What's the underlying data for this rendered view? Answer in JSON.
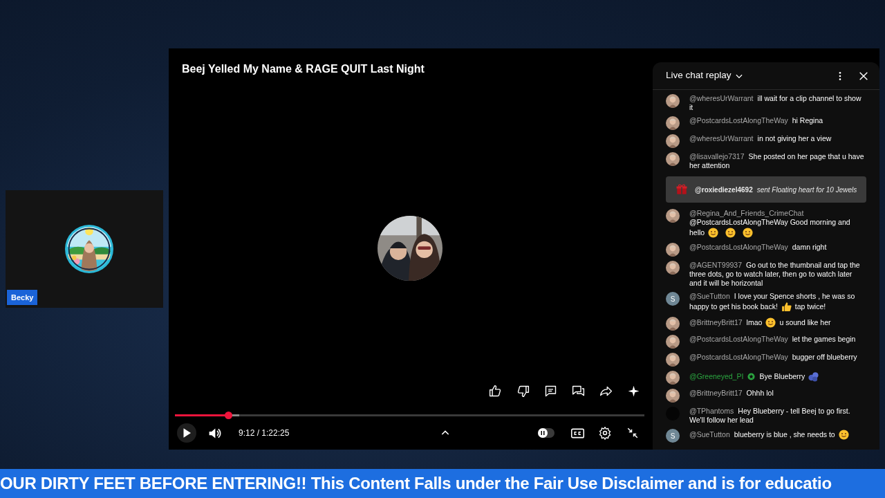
{
  "camera_tile": {
    "name_tag": "Becky"
  },
  "player": {
    "title": "Beej Yelled My Name & RAGE QUIT Last Night",
    "progress": {
      "level": 0.113
    },
    "buffer": {
      "level": 0.137
    },
    "playing": false,
    "time": "9:12 / 1:22:25",
    "autoplay": {
      "on": false
    }
  },
  "chat": {
    "title": "Live chat replay",
    "messages": [
      {
        "kind": "message",
        "badge": false,
        "avatar": {
          "kind": "picture"
        },
        "lines": [
          [
            {
              "kind": "author",
              "text": "@wheresUrWarrant",
              "color": "#aaaaaa"
            },
            {
              "kind": "text",
              "text": "ill wait for a clip channel to show"
            }
          ],
          [
            {
              "kind": "text",
              "text": "it"
            }
          ]
        ]
      },
      {
        "kind": "message",
        "badge": false,
        "avatar": {
          "kind": "picture"
        },
        "lines": [
          [
            {
              "kind": "author",
              "text": "@PostcardsLostAlongTheWay",
              "color": "#aaaaaa"
            },
            {
              "kind": "text",
              "text": "hi Regina"
            }
          ]
        ]
      },
      {
        "kind": "message",
        "badge": false,
        "avatar": {
          "kind": "picture"
        },
        "lines": [
          [
            {
              "kind": "author",
              "text": "@wheresUrWarrant",
              "color": "#aaaaaa"
            },
            {
              "kind": "text",
              "text": "in not giving her a view"
            }
          ]
        ]
      },
      {
        "kind": "message",
        "badge": false,
        "avatar": {
          "kind": "picture"
        },
        "lines": [
          [
            {
              "kind": "author",
              "text": "@lisavallejo7317",
              "color": "#aaaaaa"
            },
            {
              "kind": "text",
              "text": "She posted on her page that u have"
            }
          ],
          [
            {
              "kind": "text",
              "text": "her attention"
            }
          ]
        ]
      },
      {
        "kind": "gift",
        "author": "@roxiediezel4692",
        "text": "sent Floating heart for 10 Jewels"
      },
      {
        "kind": "message",
        "badge": false,
        "avatar": {
          "kind": "picture"
        },
        "lines": [
          [
            {
              "kind": "author",
              "text": "@Regina_And_Friends_CrimeChat",
              "color": "#aaaaaa"
            }
          ],
          [
            {
              "kind": "text",
              "text": "@PostcardsLostAlongTheWay Good morning and"
            }
          ],
          [
            {
              "kind": "text",
              "text": "hello"
            },
            {
              "kind": "emoji-face"
            },
            {
              "kind": "emoji-face"
            },
            {
              "kind": "emoji-face"
            }
          ]
        ]
      },
      {
        "kind": "message",
        "badge": false,
        "avatar": {
          "kind": "picture"
        },
        "lines": [
          [
            {
              "kind": "author",
              "text": "@PostcardsLostAlongTheWay",
              "color": "#aaaaaa"
            },
            {
              "kind": "text",
              "text": "damn right"
            }
          ]
        ]
      },
      {
        "kind": "message",
        "badge": false,
        "avatar": {
          "kind": "picture"
        },
        "lines": [
          [
            {
              "kind": "author",
              "text": "@AGENT99937",
              "color": "#aaaaaa"
            },
            {
              "kind": "text",
              "text": "Go out to the thumbnail and tap the"
            }
          ],
          [
            {
              "kind": "text",
              "text": "three dots, go to watch later, then go to watch later"
            }
          ],
          [
            {
              "kind": "text",
              "text": "and it will be horizontal"
            }
          ]
        ]
      },
      {
        "kind": "message",
        "badge": false,
        "avatar": {
          "kind": "letter",
          "text": "S"
        },
        "lines": [
          [
            {
              "kind": "author",
              "text": "@SueTutton",
              "color": "#aaaaaa"
            },
            {
              "kind": "text",
              "text": "I love your Spence shorts , he was so"
            }
          ],
          [
            {
              "kind": "text",
              "text": "happy to get his book back!"
            },
            {
              "kind": "emoji-thumb"
            },
            {
              "kind": "text",
              "text": "tap twice!"
            }
          ]
        ]
      },
      {
        "kind": "message",
        "badge": false,
        "avatar": {
          "kind": "picture"
        },
        "lines": [
          [
            {
              "kind": "author",
              "text": "@BrittneyBritt17",
              "color": "#aaaaaa"
            },
            {
              "kind": "text",
              "text": "lmao"
            },
            {
              "kind": "emoji-face"
            },
            {
              "kind": "text",
              "text": "u sound like her"
            }
          ]
        ]
      },
      {
        "kind": "message",
        "badge": false,
        "avatar": {
          "kind": "picture"
        },
        "lines": [
          [
            {
              "kind": "author",
              "text": "@PostcardsLostAlongTheWay",
              "color": "#aaaaaa"
            },
            {
              "kind": "text",
              "text": "let the games begin"
            }
          ]
        ]
      },
      {
        "kind": "message",
        "badge": false,
        "avatar": {
          "kind": "picture"
        },
        "lines": [
          [
            {
              "kind": "author",
              "text": "@PostcardsLostAlongTheWay",
              "color": "#aaaaaa"
            },
            {
              "kind": "text",
              "text": "bugger off blueberry"
            }
          ]
        ]
      },
      {
        "kind": "message",
        "badge": true,
        "avatar": {
          "kind": "picture"
        },
        "lines": [
          [
            {
              "kind": "author",
              "text": "@Greeneyed_PI",
              "color": "#2ba640"
            },
            {
              "kind": "text",
              "text": "Bye Blueberry"
            },
            {
              "kind": "emoji-berry"
            }
          ]
        ]
      },
      {
        "kind": "message",
        "badge": false,
        "avatar": {
          "kind": "picture"
        },
        "lines": [
          [
            {
              "kind": "author",
              "text": "@BrittneyBritt17",
              "color": "#aaaaaa"
            },
            {
              "kind": "text",
              "text": "Ohhh lol"
            }
          ]
        ]
      },
      {
        "kind": "message",
        "badge": false,
        "avatar": {
          "kind": "blank"
        },
        "lines": [
          [
            {
              "kind": "author",
              "text": "@TPhantoms",
              "color": "#aaaaaa"
            },
            {
              "kind": "text",
              "text": "Hey Blueberry - tell Beej to go first."
            }
          ],
          [
            {
              "kind": "text",
              "text": "We'll follow her lead"
            }
          ]
        ]
      },
      {
        "kind": "message",
        "badge": false,
        "avatar": {
          "kind": "letter",
          "text": "S"
        },
        "lines": [
          [
            {
              "kind": "author",
              "text": "@SueTutton",
              "color": "#aaaaaa"
            },
            {
              "kind": "text",
              "text": "blueberry is blue , she needs to"
            },
            {
              "kind": "emoji-face"
            }
          ]
        ]
      }
    ]
  },
  "ticker": {
    "text": "OUR DIRTY FEET BEFORE ENTERING!! This Content Falls under the Fair Use Disclaimer and is for educatio"
  }
}
